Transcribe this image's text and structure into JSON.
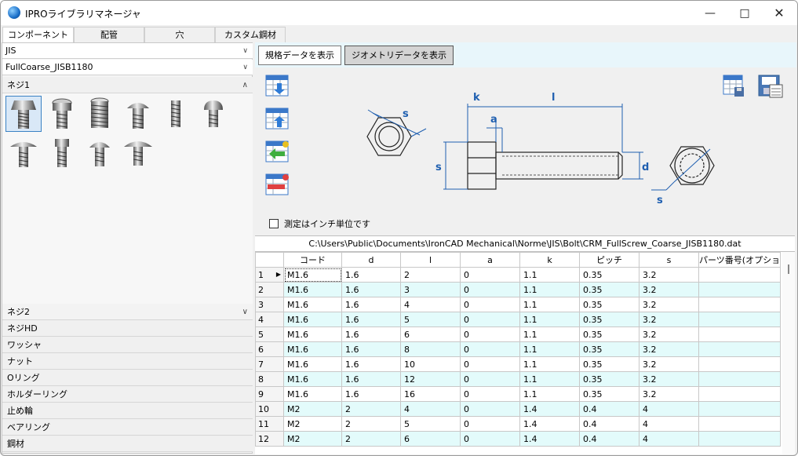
{
  "window": {
    "title": "IPROライブラリマネージャ"
  },
  "tabs": [
    "コンポーネント",
    "配管",
    "穴",
    "カスタム鋼材"
  ],
  "left": {
    "standard": "JIS",
    "library": "FullCoarse_JISB1180",
    "open_group": "ネジ1",
    "groups": [
      "ネジ2",
      "ネジHD",
      "ワッシャ",
      "ナット",
      "Oリング",
      "ホルダーリング",
      "止め輪",
      "ベアリング",
      "鋼材"
    ]
  },
  "buttons": {
    "spec": "規格データを表示",
    "geometry": "ジオメトリデータを表示"
  },
  "drawing": {
    "labels": {
      "s": "s",
      "k": "k",
      "l": "l",
      "a": "a",
      "d": "d"
    }
  },
  "metric_label": "測定はインチ単位です",
  "table": {
    "path": "C:\\Users\\Public\\Documents\\IronCAD Mechanical\\Norme\\JIS\\Bolt\\CRM_FullScrew_Coarse_JISB1180.dat",
    "columns": [
      "コード",
      "d",
      "l",
      "a",
      "k",
      "ピッチ",
      "s",
      "パーツ番号(オプショ"
    ],
    "rows": [
      [
        "1",
        "M1.6",
        "1.6",
        "2",
        "0",
        "1.1",
        "0.35",
        "3.2",
        ""
      ],
      [
        "2",
        "M1.6",
        "1.6",
        "3",
        "0",
        "1.1",
        "0.35",
        "3.2",
        ""
      ],
      [
        "3",
        "M1.6",
        "1.6",
        "4",
        "0",
        "1.1",
        "0.35",
        "3.2",
        ""
      ],
      [
        "4",
        "M1.6",
        "1.6",
        "5",
        "0",
        "1.1",
        "0.35",
        "3.2",
        ""
      ],
      [
        "5",
        "M1.6",
        "1.6",
        "6",
        "0",
        "1.1",
        "0.35",
        "3.2",
        ""
      ],
      [
        "6",
        "M1.6",
        "1.6",
        "8",
        "0",
        "1.1",
        "0.35",
        "3.2",
        ""
      ],
      [
        "7",
        "M1.6",
        "1.6",
        "10",
        "0",
        "1.1",
        "0.35",
        "3.2",
        ""
      ],
      [
        "8",
        "M1.6",
        "1.6",
        "12",
        "0",
        "1.1",
        "0.35",
        "3.2",
        ""
      ],
      [
        "9",
        "M1.6",
        "1.6",
        "16",
        "0",
        "1.1",
        "0.35",
        "3.2",
        ""
      ],
      [
        "10",
        "M2",
        "2",
        "4",
        "0",
        "1.4",
        "0.4",
        "4",
        ""
      ],
      [
        "11",
        "M2",
        "2",
        "5",
        "0",
        "1.4",
        "0.4",
        "4",
        ""
      ],
      [
        "12",
        "M2",
        "2",
        "6",
        "0",
        "1.4",
        "0.4",
        "4",
        ""
      ]
    ]
  },
  "colors": {
    "row_alt": "#e3fbfb",
    "dim_blue": "#1f5fb0",
    "button_bar": "#e8f6fb"
  }
}
